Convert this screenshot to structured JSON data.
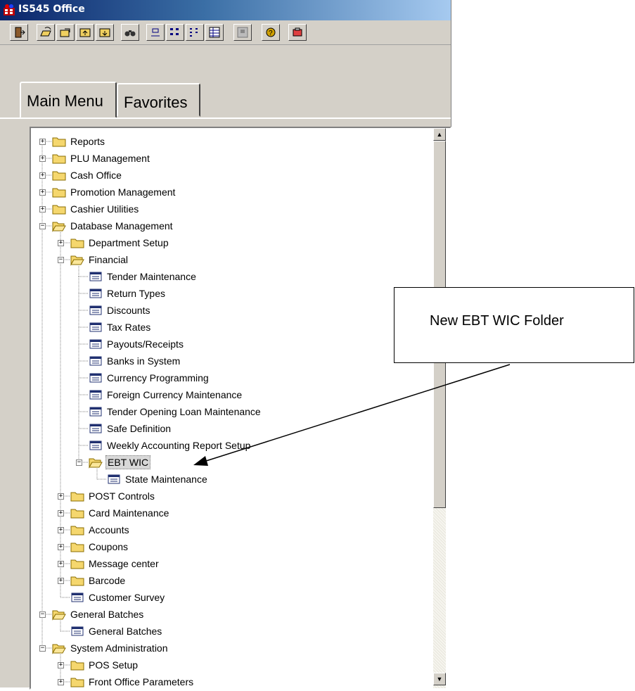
{
  "window": {
    "title": "IS545 Office"
  },
  "toolbar": {
    "buttons": [
      {
        "icon": "exit-icon"
      },
      {
        "icon": "open-icon"
      },
      {
        "icon": "export-icon"
      },
      {
        "icon": "up-folder-icon"
      },
      {
        "icon": "import-icon"
      },
      {
        "icon": "find-icon"
      },
      {
        "icon": "large-icons-view-icon"
      },
      {
        "icon": "small-icons-view-icon"
      },
      {
        "icon": "list-view-icon"
      },
      {
        "icon": "details-view-icon"
      },
      {
        "icon": "network-icon"
      },
      {
        "icon": "help-icon"
      },
      {
        "icon": "tools-icon"
      }
    ]
  },
  "tabs": {
    "main": "Main Menu",
    "favorites": "Favorites"
  },
  "tree": {
    "items": [
      {
        "label": "Reports",
        "level": 0,
        "type": "folder",
        "state": "collapsed"
      },
      {
        "label": "PLU Management",
        "level": 0,
        "type": "folder",
        "state": "collapsed"
      },
      {
        "label": "Cash Office",
        "level": 0,
        "type": "folder",
        "state": "collapsed"
      },
      {
        "label": "Promotion Management",
        "level": 0,
        "type": "folder",
        "state": "collapsed"
      },
      {
        "label": "Cashier Utilities",
        "level": 0,
        "type": "folder",
        "state": "collapsed"
      },
      {
        "label": "Database Management",
        "level": 0,
        "type": "folder",
        "state": "expanded"
      },
      {
        "label": "Department Setup",
        "level": 1,
        "type": "folder",
        "state": "collapsed"
      },
      {
        "label": "Financial",
        "level": 1,
        "type": "folder",
        "state": "expanded"
      },
      {
        "label": "Tender Maintenance",
        "level": 2,
        "type": "form"
      },
      {
        "label": "Return Types",
        "level": 2,
        "type": "form"
      },
      {
        "label": "Discounts",
        "level": 2,
        "type": "form"
      },
      {
        "label": "Tax Rates",
        "level": 2,
        "type": "form"
      },
      {
        "label": "Payouts/Receipts",
        "level": 2,
        "type": "form"
      },
      {
        "label": "Banks in System",
        "level": 2,
        "type": "form"
      },
      {
        "label": "Currency Programming",
        "level": 2,
        "type": "form"
      },
      {
        "label": "Foreign Currency Maintenance",
        "level": 2,
        "type": "form"
      },
      {
        "label": "Tender Opening Loan Maintenance",
        "level": 2,
        "type": "form"
      },
      {
        "label": "Safe Definition",
        "level": 2,
        "type": "form"
      },
      {
        "label": "Weekly Accounting Report Setup",
        "level": 2,
        "type": "form"
      },
      {
        "label": "EBT WIC",
        "level": 2,
        "type": "folder",
        "state": "expanded",
        "selected": true
      },
      {
        "label": "State Maintenance",
        "level": 3,
        "type": "form"
      },
      {
        "label": "POST Controls",
        "level": 1,
        "type": "folder",
        "state": "collapsed"
      },
      {
        "label": "Card Maintenance",
        "level": 1,
        "type": "folder",
        "state": "collapsed"
      },
      {
        "label": "Accounts",
        "level": 1,
        "type": "folder",
        "state": "collapsed"
      },
      {
        "label": "Coupons",
        "level": 1,
        "type": "folder",
        "state": "collapsed"
      },
      {
        "label": "Message center",
        "level": 1,
        "type": "folder",
        "state": "collapsed"
      },
      {
        "label": "Barcode",
        "level": 1,
        "type": "folder",
        "state": "collapsed"
      },
      {
        "label": "Customer Survey",
        "level": 1,
        "type": "form"
      },
      {
        "label": "General Batches",
        "level": 0,
        "type": "folder",
        "state": "expanded"
      },
      {
        "label": "General Batches",
        "level": 1,
        "type": "form"
      },
      {
        "label": "System Administration",
        "level": 0,
        "type": "folder",
        "state": "expanded"
      },
      {
        "label": "POS Setup",
        "level": 1,
        "type": "folder",
        "state": "collapsed"
      },
      {
        "label": "Front Office Parameters",
        "level": 1,
        "type": "folder",
        "state": "collapsed"
      }
    ]
  },
  "scrollbar": {
    "up": "▲",
    "down": "▼"
  },
  "callout": {
    "text": "New EBT WIC Folder"
  }
}
